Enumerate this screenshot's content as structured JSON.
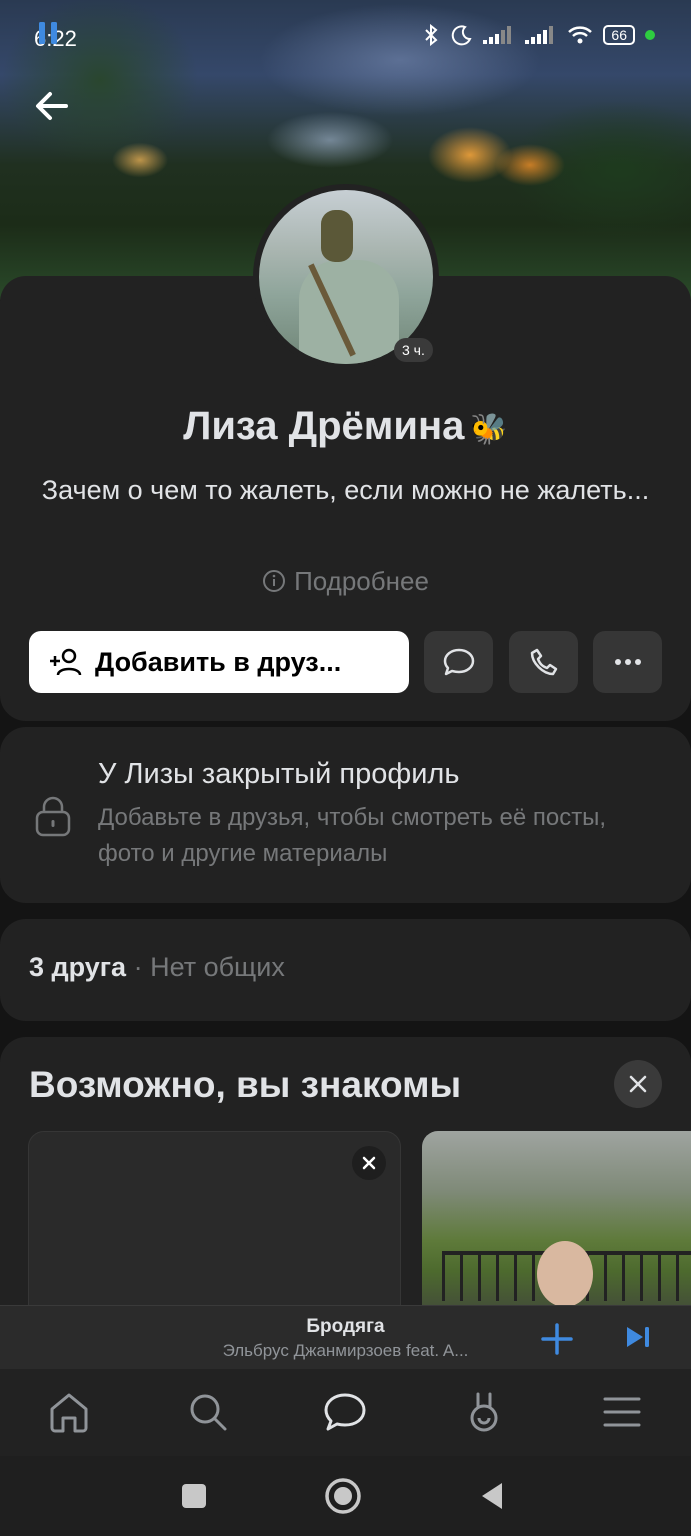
{
  "status_bar": {
    "time": "6:22",
    "battery": "66"
  },
  "profile": {
    "name": "Лиза Дрёмина",
    "name_emoji": "🐝",
    "avatar_time": "3 ч.",
    "status": "Зачем о чем то жалеть, если можно не жалеть...",
    "more_info": "Подробнее"
  },
  "actions": {
    "add_friend": "Добавить в друз...",
    "message_icon": "chat-bubble-icon",
    "call_icon": "phone-icon",
    "more_icon": "more-dots-icon"
  },
  "closed_profile": {
    "title": "У Лизы закрытый профиль",
    "description": "Добавьте в друзья, чтобы смотреть её посты, фото и другие материалы"
  },
  "friends": {
    "count": "3 друга",
    "separator": " · ",
    "mutual": "Нет общих"
  },
  "suggestions": {
    "title": "Возможно, вы знакомы"
  },
  "player": {
    "title": "Бродяга",
    "artist": "Эльбрус Джанмирзоев feat. A..."
  },
  "tabs": [
    {
      "name": "home",
      "icon": "home-icon"
    },
    {
      "name": "search",
      "icon": "search-icon"
    },
    {
      "name": "messenger",
      "icon": "chat-icon"
    },
    {
      "name": "clips",
      "icon": "clips-icon"
    },
    {
      "name": "menu",
      "icon": "menu-icon"
    }
  ],
  "colors": {
    "accent": "#3f8ae0",
    "background": "#141414",
    "card": "#222222",
    "secondary_text": "#76787a"
  }
}
